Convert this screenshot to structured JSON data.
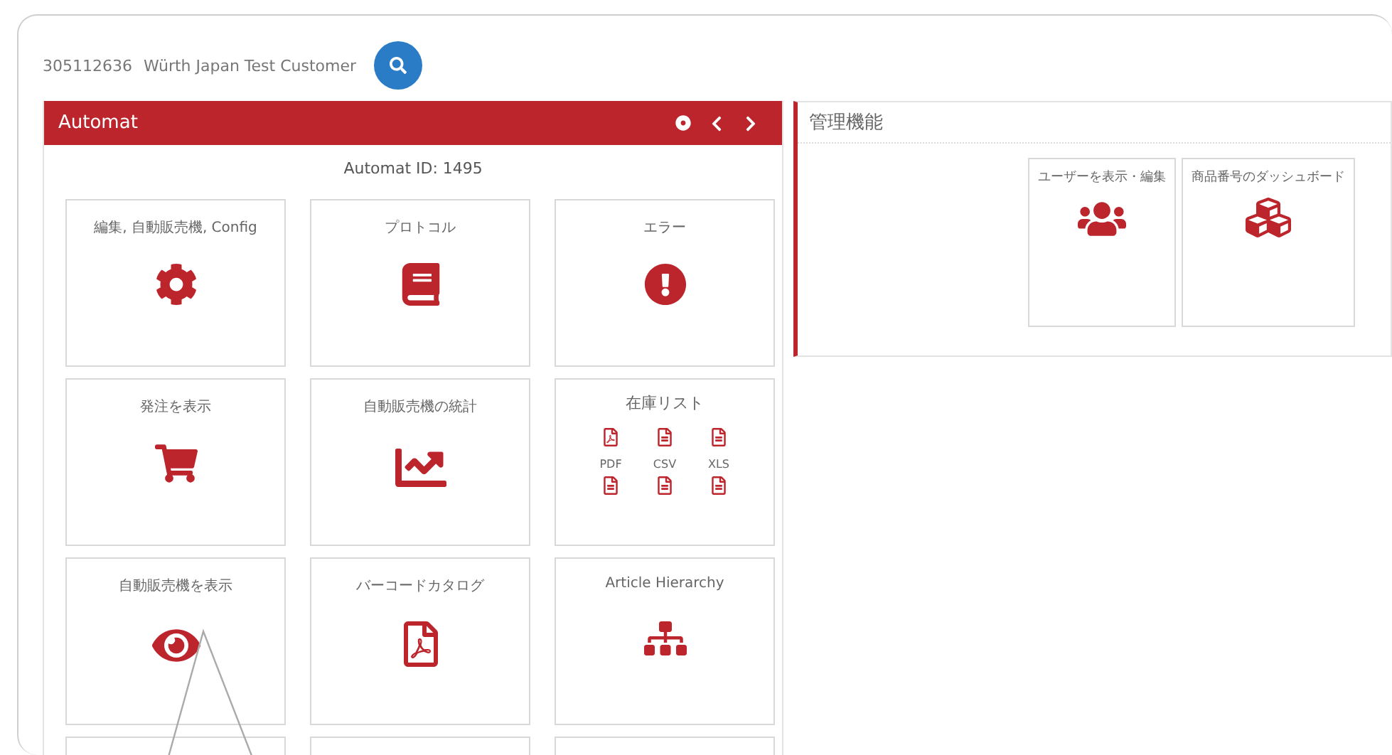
{
  "customer": {
    "number": "305112636",
    "name": "Würth Japan Test Customer"
  },
  "automat_panel": {
    "title": "Automat",
    "automat_id": "Automat ID: 1495",
    "tiles": [
      {
        "kind": "icon",
        "label": "編集, 自動販売機, Config"
      },
      {
        "kind": "icon",
        "label": "プロトコル"
      },
      {
        "kind": "icon",
        "label": "エラー"
      },
      {
        "kind": "icon",
        "label": "発注を表示"
      },
      {
        "kind": "icon",
        "label": "自動販売機の統計"
      },
      {
        "kind": "files",
        "label": "在庫リスト",
        "files": [
          "PDF",
          "CSV",
          "XLS"
        ]
      },
      {
        "kind": "icon",
        "label": "自動販売機を表示"
      },
      {
        "kind": "icon",
        "label": "バーコードカタログ"
      },
      {
        "kind": "icon",
        "label": "Article Hierarchy"
      },
      {
        "kind": "cut_off"
      },
      {
        "kind": "cut_off"
      },
      {
        "kind": "cut_off"
      }
    ]
  },
  "admin_panel": {
    "title": "管理機能",
    "tiles": [
      {
        "kind": "icon",
        "label": "ユーザーを表示・編集"
      },
      {
        "kind": "icon",
        "label": "商品番号のダッシュボード"
      }
    ]
  }
}
